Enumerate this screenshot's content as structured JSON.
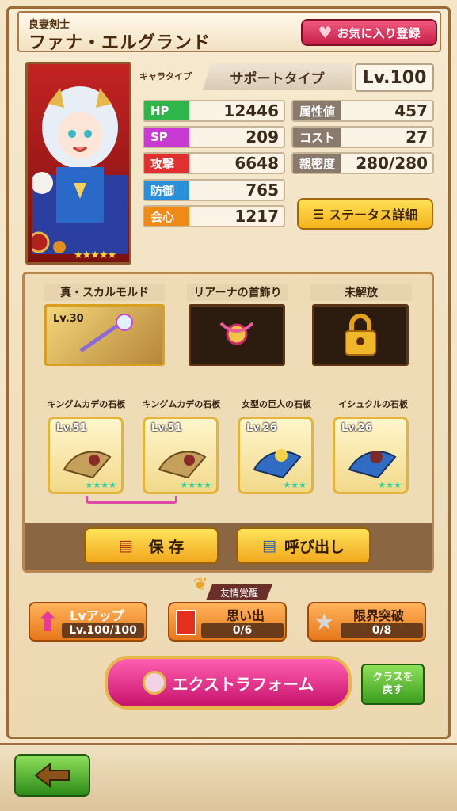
{
  "header": {
    "subtitle": "良妻剣士",
    "name": "ファナ・エルグランド",
    "favorite_label": "お気に入り登録"
  },
  "profile": {
    "chara_type_label": "キャラタイプ",
    "chara_type": "サポートタイプ",
    "level": "Lv.100"
  },
  "stats_left": [
    {
      "label": "HP",
      "value": "12446",
      "color": "#2fb54a"
    },
    {
      "label": "SP",
      "value": "209",
      "color": "#c83ad1"
    },
    {
      "label": "攻撃",
      "value": "6648",
      "color": "#e0302f"
    },
    {
      "label": "防御",
      "value": "765",
      "color": "#2a8ed8"
    },
    {
      "label": "会心",
      "value": "1217",
      "color": "#ef8a17"
    }
  ],
  "stats_right": [
    {
      "label": "属性値",
      "value": "457",
      "color": "#8a7a6c"
    },
    {
      "label": "コスト",
      "value": "27",
      "color": "#8a7a6c"
    },
    {
      "label": "親密度",
      "value": "280/280",
      "color": "#8a7a6c"
    }
  ],
  "status_detail_label": "ステータス詳細",
  "equipment": [
    {
      "label": "真・スカルモルド",
      "level": "Lv.30"
    },
    {
      "label": "リアーナの首飾り"
    },
    {
      "label": "未解放"
    }
  ],
  "stones": [
    {
      "label": "キングムカデの石板",
      "level": "Lv.51",
      "stars": "★★★★"
    },
    {
      "label": "キングムカデの石板",
      "level": "Lv.51",
      "stars": "★★★★"
    },
    {
      "label": "女型の巨人の石板",
      "level": "Lv.26",
      "stars": "★★★"
    },
    {
      "label": "イシュクルの石板",
      "level": "Lv.26",
      "stars": "★★★"
    }
  ],
  "actions": {
    "save": "保 存",
    "load": "呼び出し"
  },
  "progress": {
    "lvup_label": "Lvアップ",
    "lvup_value": "Lv.100/100",
    "friendship_tag": "友情覚醒",
    "memory_label": "思い出",
    "memory_value": "0/6",
    "limit_label": "限界突破",
    "limit_value": "0/8"
  },
  "extra_form_label": "エクストラフォーム",
  "class_back_label": "クラスを戻す",
  "icons": [
    "heart-icon",
    "star-icon",
    "list-icon",
    "lock-icon",
    "arrow-up-icon",
    "card-icon",
    "back-arrow-icon"
  ]
}
